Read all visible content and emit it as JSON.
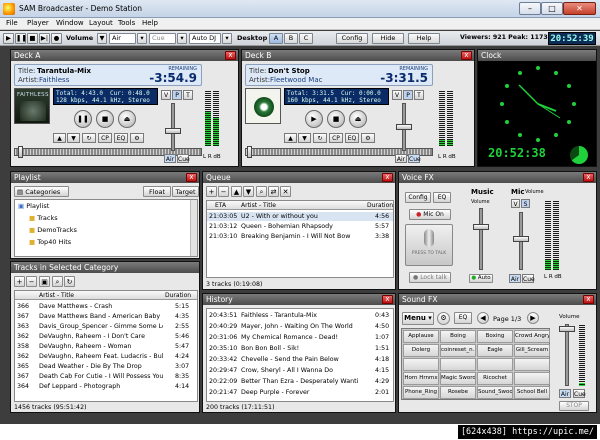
{
  "app": {
    "title": "SAM Broadcaster - Demo Station"
  },
  "window_controls": {
    "minimize": "–",
    "maximize": "□",
    "close": "✕"
  },
  "menu": [
    "File",
    "Player",
    "Window",
    "Layout",
    "Tools",
    "Help"
  ],
  "toolbar": {
    "volume_label": "Volume",
    "air_select": "Air",
    "cue_select": "Cue",
    "autodj": "Auto DJ",
    "desktop_label": "Desktop",
    "desktops": [
      "A",
      "B",
      "C"
    ],
    "config": "Config",
    "hide": "Hide",
    "help": "Help",
    "listeners": "Viewers: 921  Peak: 1173",
    "time": "20:52:39"
  },
  "deck_a": {
    "title": "Deck A",
    "title_label": "Title:",
    "title_value": "Tarantula-Mix",
    "artist_label": "Artist:",
    "artist_value": "Faithless",
    "remaining_label": "REMAINING",
    "remaining": "-3:54.9",
    "total": "Total: 4:43.0",
    "cur": "Cur: 0:48.0",
    "format": "128 kbps, 44.1 kHz, Stereo",
    "cover_text": "FAITHLESS",
    "air_btn": "Air",
    "cue_btn": "Cue",
    "vpt": [
      "V",
      "P",
      "T"
    ],
    "cp": "CP",
    "eq": "EQ",
    "lr": "L R dB"
  },
  "deck_b": {
    "title": "Deck B",
    "title_label": "Title:",
    "title_value": "Don't Stop",
    "artist_label": "Artist:",
    "artist_value": "Fleetwood Mac",
    "remaining_label": "REMAINING",
    "remaining": "-3:31.5",
    "total": "Total: 3:31.5",
    "cur": "Cur: 0:00.0",
    "format": "160 kbps, 44.1 kHz, Stereo",
    "air_btn": "Air",
    "cue_btn": "Cue",
    "vpt": [
      "V",
      "P",
      "T"
    ],
    "cp": "CP",
    "eq": "EQ",
    "lr": "L R dB"
  },
  "clock": {
    "title": "Clock",
    "digital": "20:52:38"
  },
  "playlist": {
    "title": "Playlist",
    "categories_btn": "Categories",
    "float_btn": "Float",
    "target_btn": "Target",
    "tree": [
      "Playlist",
      "Tracks",
      "DemoTracks",
      "Top40 Hits"
    ]
  },
  "tracks": {
    "title": "Tracks in Selected Category",
    "col_artist": "Artist - Title",
    "col_duration": "Duration",
    "rows": [
      {
        "n": "366",
        "t": "Dave Matthews - Crash",
        "d": "5:15"
      },
      {
        "n": "367",
        "t": "Dave Matthews Band - American Baby",
        "d": "4:35"
      },
      {
        "n": "363",
        "t": "Davis_Group_Spencer - Gimme Some Lo",
        "d": "2:55"
      },
      {
        "n": "362",
        "t": "DeVaughn, Raheem - I Don't Care",
        "d": "5:46"
      },
      {
        "n": "358",
        "t": "DeVaughn, Raheem - Woman",
        "d": "5:47"
      },
      {
        "n": "362",
        "t": "DeVaughn, Raheem Feat. Ludacris - Bull",
        "d": "4:24"
      },
      {
        "n": "365",
        "t": "Dead Weather - Die By The Drop",
        "d": "3:07"
      },
      {
        "n": "367",
        "t": "Death Cab For Cutie - I Will Possess Your",
        "d": "8:35"
      },
      {
        "n": "364",
        "t": "Def Leppard - Photograph",
        "d": "4:14"
      }
    ],
    "status": "1456 tracks (95:51:42)"
  },
  "queue": {
    "title": "Queue",
    "col_eta": "ETA",
    "col_artist": "Artist - Title",
    "col_duration": "Duration",
    "rows": [
      {
        "eta": "21:03:05",
        "t": "U2 - With or without you",
        "d": "4:56"
      },
      {
        "eta": "21:03:12",
        "t": "Queen - Bohemian Rhapsody",
        "d": "5:57"
      },
      {
        "eta": "21:03:10",
        "t": "Breaking Benjamin - I Will Not Bow",
        "d": "3:38"
      }
    ],
    "status": "3 tracks (0:19:08)"
  },
  "history": {
    "title": "History",
    "rows": [
      {
        "time": "20:43:51",
        "t": "Faithless - Tarantula-Mix",
        "d": "0:43"
      },
      {
        "time": "20:40:29",
        "t": "Mayer, John - Waiting On The World",
        "d": "4:50"
      },
      {
        "time": "20:31:06",
        "t": "My Chemical Romance - Dead!",
        "d": "1:07"
      },
      {
        "time": "20:35:10",
        "t": "Bon Bon Boll - Sik!",
        "d": "1:51"
      },
      {
        "time": "20:33:42",
        "t": "Chevelle - Send the Pain Below",
        "d": "4:18"
      },
      {
        "time": "20:29:47",
        "t": "Crow, Sheryl - All I Wanna Do",
        "d": "4:15"
      },
      {
        "time": "20:22:09",
        "t": "Better Than Ezra - Desperately Wanti",
        "d": "4:29"
      },
      {
        "time": "20:21:47",
        "t": "Deep Purple - Forever",
        "d": "2:01"
      }
    ],
    "status": "200 tracks (17:11:51)"
  },
  "voicefx": {
    "title": "Voice FX",
    "config": "Config",
    "eq": "EQ",
    "mic_on": "Mic On",
    "press_talk": "PRESS TO TALK",
    "lock_talk": "Lock talk",
    "music_label": "Music",
    "music_vol": "Volume",
    "mic_label": "Mic",
    "mic_vol": "Volume",
    "auto": "Auto",
    "vs": [
      "V",
      "S"
    ],
    "air": "Air",
    "cue": "Cue",
    "lr": "L R dB"
  },
  "soundfx": {
    "title": "Sound FX",
    "menu": "Menu",
    "eq": "EQ",
    "page": "Page 1/3",
    "volume": "Volume",
    "air": "Air",
    "cue": "Cue",
    "stop": "STOP",
    "cells": [
      "Applause",
      "Boing",
      "Boxing",
      "Crowd Angry",
      "Dolerg",
      "coinreset_n...",
      "Eagle",
      "Gill_Scream",
      "",
      "",
      "",
      "",
      "Horn Hrnmx",
      "Magic Sword",
      "Ricochet",
      "",
      "Phone_Ring",
      "Rosebe",
      "Sound_Swoosh",
      "School Bell"
    ]
  },
  "watermark": "[624x438] https://upic.me/"
}
